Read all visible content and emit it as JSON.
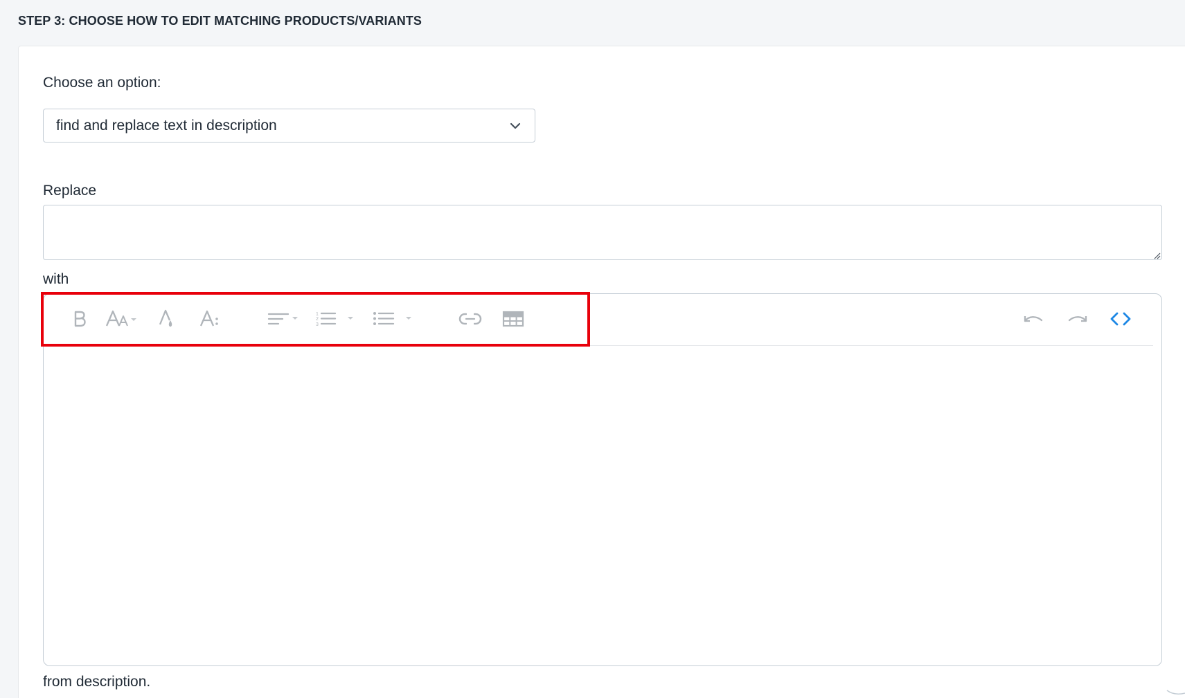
{
  "step": {
    "heading": "STEP 3: CHOOSE HOW TO EDIT MATCHING PRODUCTS/VARIANTS"
  },
  "form": {
    "option_label": "Choose an option:",
    "option_selected": "find and replace text in description",
    "replace_label": "Replace",
    "replace_value": "",
    "with_label": "with",
    "footer_text": "from description."
  },
  "editor": {
    "toolbar": [
      {
        "name": "bold",
        "icon": "bold-icon"
      },
      {
        "name": "font-size",
        "icon": "font-size-icon",
        "dropdown": true
      },
      {
        "name": "text-color",
        "icon": "text-color-icon"
      },
      {
        "name": "paragraph-format",
        "icon": "paragraph-format-icon"
      },
      {
        "name": "align",
        "icon": "align-left-icon",
        "dropdown": true
      },
      {
        "name": "ordered-list",
        "icon": "ordered-list-icon",
        "dropdown": true
      },
      {
        "name": "unordered-list",
        "icon": "unordered-list-icon",
        "dropdown": true
      },
      {
        "name": "insert-link",
        "icon": "link-icon"
      },
      {
        "name": "insert-table",
        "icon": "table-icon"
      },
      {
        "name": "undo",
        "icon": "undo-icon"
      },
      {
        "name": "redo",
        "icon": "redo-icon"
      },
      {
        "name": "code-view",
        "icon": "code-view-icon"
      }
    ],
    "content": ""
  },
  "colors": {
    "icon_gray": "#b0b5ba",
    "code_view_blue": "#1e88e5",
    "highlight_red": "#e8000b",
    "border": "#c4cdd5"
  }
}
